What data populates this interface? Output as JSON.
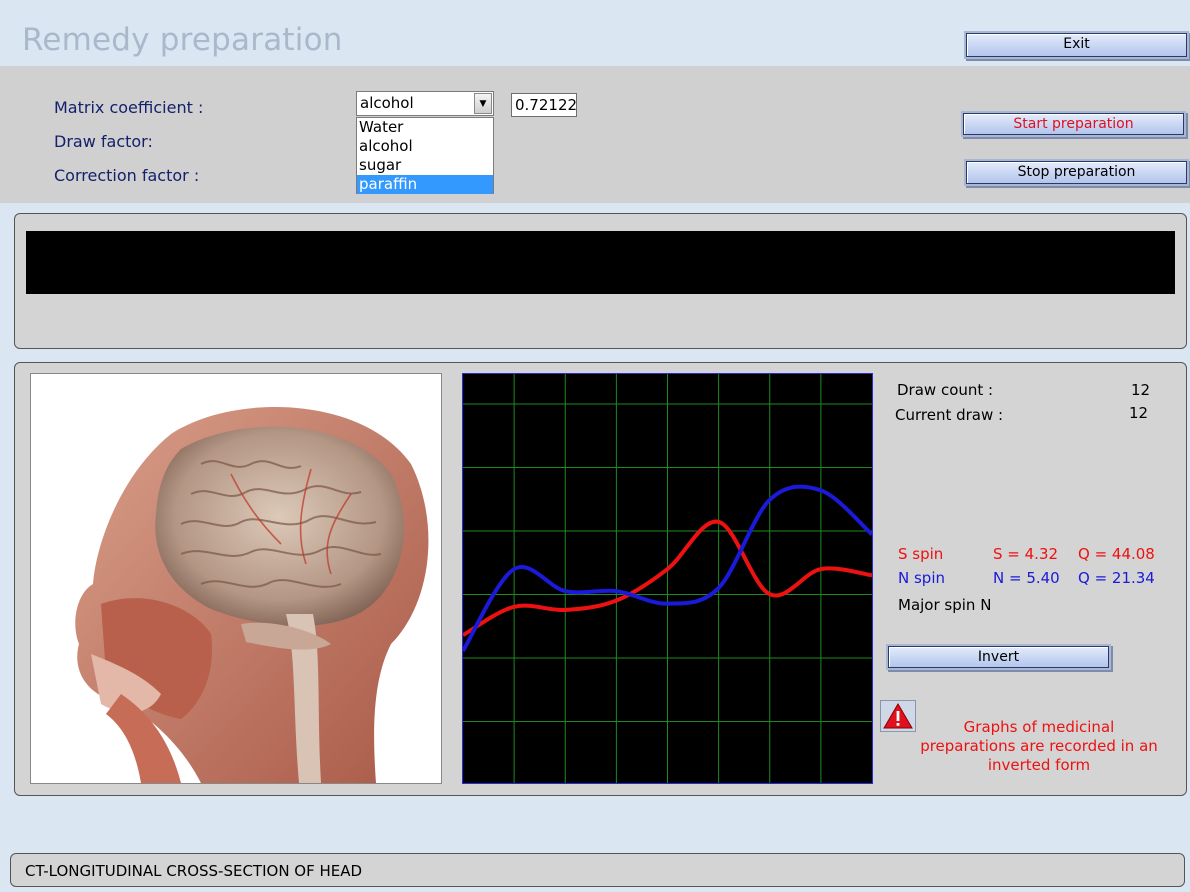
{
  "window": {
    "title": "Remedy preparation"
  },
  "buttons": {
    "exit": "Exit",
    "start": "Start preparation",
    "stop": "Stop preparation",
    "invert": "Invert"
  },
  "params": {
    "matrix_label": "Matrix coefficient :",
    "draw_label": "Draw factor:",
    "correction_label": "Correction factor :",
    "matrix_selected": "alcohol",
    "matrix_value": "0.72122",
    "options": [
      "Water",
      "alcohol",
      "sugar",
      "paraffin"
    ],
    "highlighted_option": "paraffin"
  },
  "stats": {
    "draw_count_label": "Draw count :",
    "draw_count": "12",
    "current_draw_label": "Current draw :",
    "current_draw": "12",
    "s_spin_label": "S spin",
    "s_value": "S = 4.32",
    "s_q": "Q = 44.08",
    "n_spin_label": "N spin",
    "n_value": "N = 5.40",
    "n_q": "Q = 21.34",
    "major_spin": "Major spin N"
  },
  "warning": {
    "text": "Graphs of medicinal preparations are recorded in an inverted form",
    "icon": "warning-triangle-icon"
  },
  "status_bar": {
    "text": "CT-LONGITUDINAL CROSS-SECTION OF HEAD"
  },
  "colors": {
    "accent_red": "#ee1111",
    "accent_blue": "#1a1ad8",
    "grid_green": "#1f8a1f",
    "label_navy": "#14206b"
  },
  "chart_data": {
    "type": "line",
    "title": "",
    "xlabel": "",
    "ylabel": "",
    "grid": true,
    "x": [
      0,
      1,
      2,
      3,
      4,
      5,
      6,
      7,
      8
    ],
    "xlim": [
      0,
      8
    ],
    "ylim": [
      0,
      6.5
    ],
    "series": [
      {
        "name": "",
        "color": "#ee1111",
        "values": [
          2.35,
          2.8,
          2.75,
          2.9,
          3.4,
          4.15,
          3.0,
          3.4,
          3.3
        ]
      },
      {
        "name": "",
        "color": "#1a1ad8",
        "values": [
          2.1,
          3.4,
          3.05,
          3.05,
          2.85,
          3.1,
          4.5,
          4.65,
          3.95
        ]
      }
    ]
  }
}
